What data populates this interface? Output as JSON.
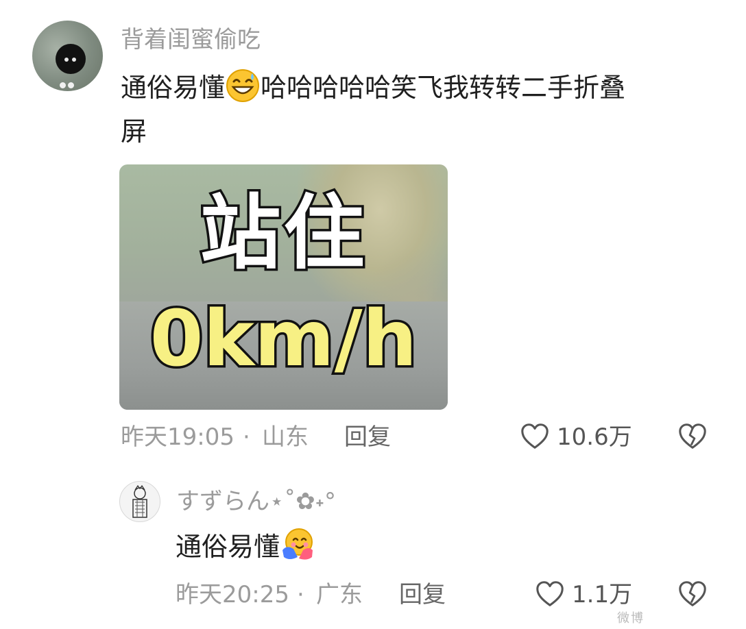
{
  "comment": {
    "username": "背着闺蜜偷吃",
    "text_line1_a": "通俗易懂",
    "text_line1_b": "哈哈哈哈哈笑飞我转转二手折叠",
    "text_line2": "屏",
    "emoji": "grinning-sweat-emoji",
    "sticker": {
      "line1": "站住",
      "line2": "0km/h"
    },
    "time": "昨天19:05",
    "separator": "·",
    "location": "山东",
    "reply_label": "回复",
    "like_count": "10.6万"
  },
  "reply": {
    "username": "すずらん⋆˚✿˖°",
    "text": "通俗易懂",
    "emoji": "hugging-face-emoji",
    "time": "昨天20:25",
    "separator": "·",
    "location": "广东",
    "reply_label": "回复",
    "like_count": "1.1万"
  },
  "watermark": "微博",
  "colors": {
    "background": "#ffffff",
    "username": "#9b9b9b",
    "text": "#1f1f1f",
    "sticker_yellow": "#f7f084"
  }
}
